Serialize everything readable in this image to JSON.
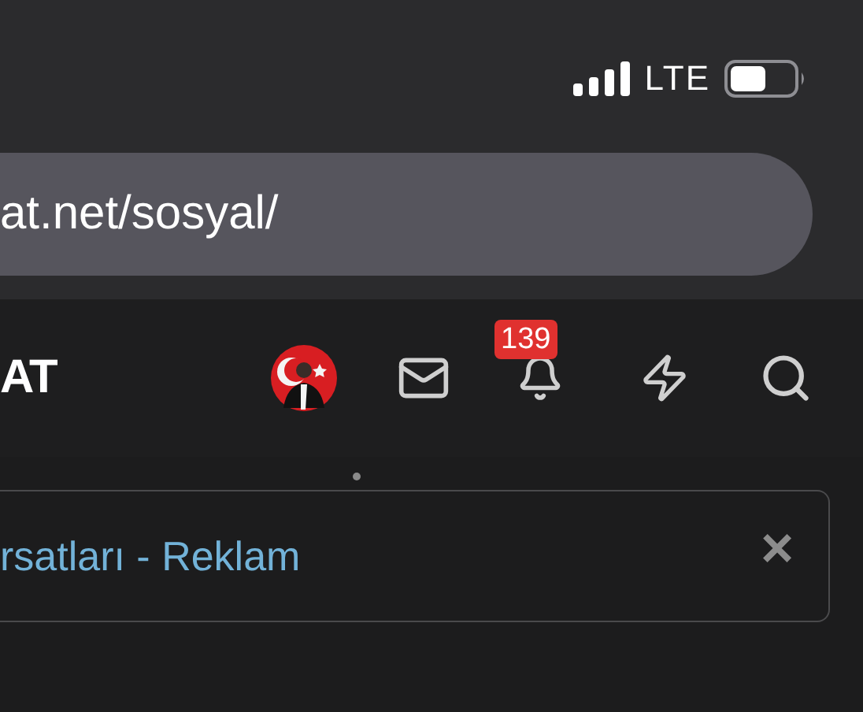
{
  "status_bar": {
    "network": "LTE"
  },
  "address_bar": {
    "url": "at.net/sosyal/"
  },
  "nav_bar": {
    "logo": "AT",
    "notification_count": "139"
  },
  "ad_banner": {
    "text": "rsatları - Reklam",
    "close": "×"
  }
}
